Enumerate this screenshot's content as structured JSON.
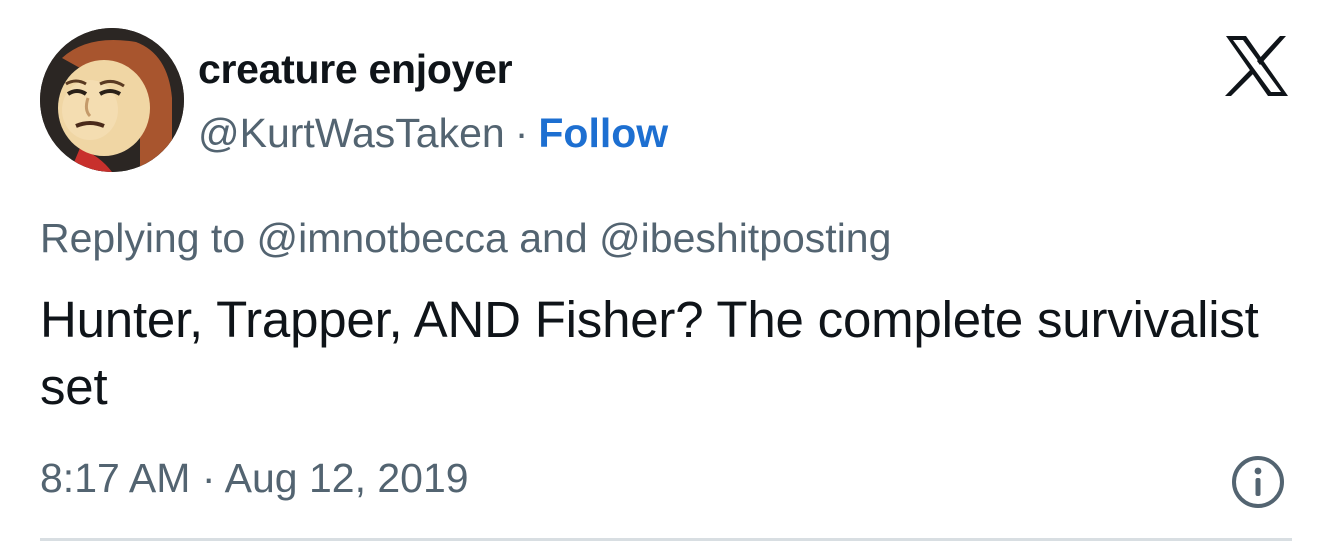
{
  "author": {
    "display_name": "creature enjoyer",
    "handle": "@KurtWasTaken",
    "separator": "·",
    "follow_label": "Follow"
  },
  "reply": {
    "prefix": "Replying to",
    "mention_1": "@imnotbecca",
    "conjunction": "and",
    "mention_2": "@ibeshitposting"
  },
  "tweet": {
    "text": "Hunter, Trapper, AND Fisher? The complete survivalist set"
  },
  "meta": {
    "time": "8:17 AM",
    "separator": "·",
    "date": "Aug 12, 2019"
  },
  "icons": {
    "brand": "x-logo-icon",
    "info": "info-icon",
    "avatar": "mii-face-avatar"
  },
  "colors": {
    "text": "#0f1419",
    "secondary": "#536471",
    "link": "#1d6fd1",
    "divider": "#d8dee2"
  }
}
